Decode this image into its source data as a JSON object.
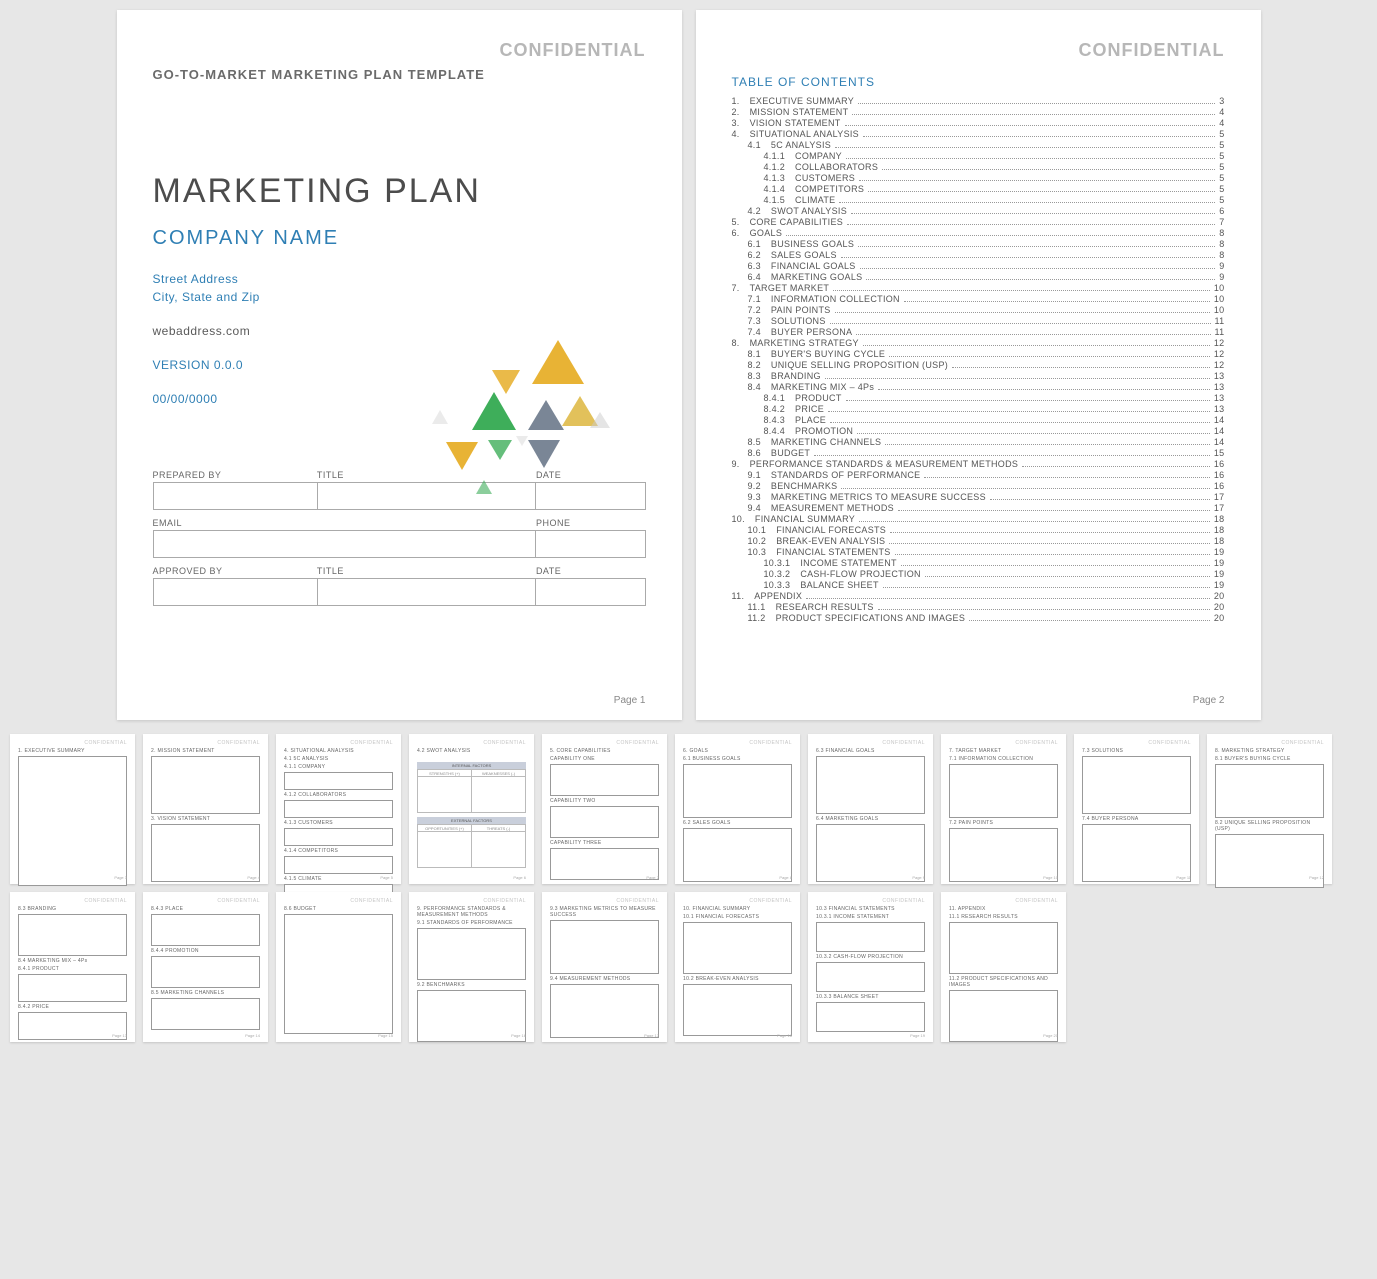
{
  "confidential": "CONFIDENTIAL",
  "template_name": "GO-TO-MARKET MARKETING PLAN TEMPLATE",
  "cover": {
    "title": "MARKETING PLAN",
    "company": "COMPANY NAME",
    "street": "Street Address",
    "csz": "City, State and Zip",
    "web": "webaddress.com",
    "version": "VERSION 0.0.0",
    "date": "00/00/0000"
  },
  "form": {
    "prepared_by": "PREPARED BY",
    "title": "TITLE",
    "date": "DATE",
    "email": "EMAIL",
    "phone": "PHONE",
    "approved_by": "APPROVED BY"
  },
  "page1": "Page 1",
  "page2": "Page 2",
  "toc_title": "TABLE OF CONTENTS",
  "toc": [
    {
      "n": "1.",
      "t": "EXECUTIVE SUMMARY",
      "p": "3",
      "i": 0
    },
    {
      "n": "2.",
      "t": "MISSION STATEMENT",
      "p": "4",
      "i": 0
    },
    {
      "n": "3.",
      "t": "VISION STATEMENT",
      "p": "4",
      "i": 0
    },
    {
      "n": "4.",
      "t": "SITUATIONAL ANALYSIS",
      "p": "5",
      "i": 0
    },
    {
      "n": "4.1",
      "t": "5C ANALYSIS",
      "p": "5",
      "i": 1
    },
    {
      "n": "4.1.1",
      "t": "COMPANY",
      "p": "5",
      "i": 2
    },
    {
      "n": "4.1.2",
      "t": "COLLABORATORS",
      "p": "5",
      "i": 2
    },
    {
      "n": "4.1.3",
      "t": "CUSTOMERS",
      "p": "5",
      "i": 2
    },
    {
      "n": "4.1.4",
      "t": "COMPETITORS",
      "p": "5",
      "i": 2
    },
    {
      "n": "4.1.5",
      "t": "CLIMATE",
      "p": "5",
      "i": 2
    },
    {
      "n": "4.2",
      "t": "SWOT ANALYSIS",
      "p": "6",
      "i": 1
    },
    {
      "n": "5.",
      "t": "CORE CAPABILITIES",
      "p": "7",
      "i": 0
    },
    {
      "n": "6.",
      "t": "GOALS",
      "p": "8",
      "i": 0
    },
    {
      "n": "6.1",
      "t": "BUSINESS GOALS",
      "p": "8",
      "i": 1
    },
    {
      "n": "6.2",
      "t": "SALES GOALS",
      "p": "8",
      "i": 1
    },
    {
      "n": "6.3",
      "t": "FINANCIAL GOALS",
      "p": "9",
      "i": 1
    },
    {
      "n": "6.4",
      "t": "MARKETING GOALS",
      "p": "9",
      "i": 1
    },
    {
      "n": "7.",
      "t": "TARGET MARKET",
      "p": "10",
      "i": 0
    },
    {
      "n": "7.1",
      "t": "INFORMATION COLLECTION",
      "p": "10",
      "i": 1
    },
    {
      "n": "7.2",
      "t": "PAIN POINTS",
      "p": "10",
      "i": 1
    },
    {
      "n": "7.3",
      "t": "SOLUTIONS",
      "p": "11",
      "i": 1
    },
    {
      "n": "7.4",
      "t": "BUYER PERSONA",
      "p": "11",
      "i": 1
    },
    {
      "n": "8.",
      "t": "MARKETING STRATEGY",
      "p": "12",
      "i": 0
    },
    {
      "n": "8.1",
      "t": "BUYER'S BUYING CYCLE",
      "p": "12",
      "i": 1
    },
    {
      "n": "8.2",
      "t": "UNIQUE SELLING PROPOSITION (USP)",
      "p": "12",
      "i": 1
    },
    {
      "n": "8.3",
      "t": "BRANDING",
      "p": "13",
      "i": 1
    },
    {
      "n": "8.4",
      "t": "MARKETING MIX – 4Ps",
      "p": "13",
      "i": 1
    },
    {
      "n": "8.4.1",
      "t": "PRODUCT",
      "p": "13",
      "i": 2
    },
    {
      "n": "8.4.2",
      "t": "PRICE",
      "p": "13",
      "i": 2
    },
    {
      "n": "8.4.3",
      "t": "PLACE",
      "p": "14",
      "i": 2
    },
    {
      "n": "8.4.4",
      "t": "PROMOTION",
      "p": "14",
      "i": 2
    },
    {
      "n": "8.5",
      "t": "MARKETING CHANNELS",
      "p": "14",
      "i": 1
    },
    {
      "n": "8.6",
      "t": "BUDGET",
      "p": "15",
      "i": 1
    },
    {
      "n": "9.",
      "t": "PERFORMANCE STANDARDS & MEASUREMENT METHODS",
      "p": "16",
      "i": 0
    },
    {
      "n": "9.1",
      "t": "STANDARDS OF PERFORMANCE",
      "p": "16",
      "i": 1
    },
    {
      "n": "9.2",
      "t": "BENCHMARKS",
      "p": "16",
      "i": 1
    },
    {
      "n": "9.3",
      "t": "MARKETING METRICS TO MEASURE SUCCESS",
      "p": "17",
      "i": 1
    },
    {
      "n": "9.4",
      "t": "MEASUREMENT METHODS",
      "p": "17",
      "i": 1
    },
    {
      "n": "10.",
      "t": "FINANCIAL SUMMARY",
      "p": "18",
      "i": 0
    },
    {
      "n": "10.1",
      "t": "FINANCIAL FORECASTS",
      "p": "18",
      "i": 1
    },
    {
      "n": "10.2",
      "t": "BREAK-EVEN ANALYSIS",
      "p": "18",
      "i": 1
    },
    {
      "n": "10.3",
      "t": "FINANCIAL STATEMENTS",
      "p": "19",
      "i": 1
    },
    {
      "n": "10.3.1",
      "t": "INCOME STATEMENT",
      "p": "19",
      "i": 2
    },
    {
      "n": "10.3.2",
      "t": "CASH-FLOW PROJECTION",
      "p": "19",
      "i": 2
    },
    {
      "n": "10.3.3",
      "t": "BALANCE SHEET",
      "p": "19",
      "i": 2
    },
    {
      "n": "11.",
      "t": "APPENDIX",
      "p": "20",
      "i": 0
    },
    {
      "n": "11.1",
      "t": "RESEARCH RESULTS",
      "p": "20",
      "i": 1
    },
    {
      "n": "11.2",
      "t": "PRODUCT SPECIFICATIONS AND IMAGES",
      "p": "20",
      "i": 1
    }
  ],
  "thumbs": [
    {
      "p": "3",
      "sections": [
        {
          "h": "1. EXECUTIVE SUMMARY",
          "hb": 130
        }
      ]
    },
    {
      "p": "4",
      "sections": [
        {
          "h": "2. MISSION STATEMENT",
          "hb": 58
        },
        {
          "h": "3. VISION STATEMENT",
          "hb": 58
        }
      ]
    },
    {
      "p": "5",
      "sections": [
        {
          "h": "4. SITUATIONAL ANALYSIS",
          "hb": 0
        },
        {
          "h": "4.1 5C ANALYSIS",
          "hb": 0
        },
        {
          "h": "4.1.1 COMPANY",
          "hb": 18
        },
        {
          "h": "4.1.2 COLLABORATORS",
          "hb": 18
        },
        {
          "h": "4.1.3 CUSTOMERS",
          "hb": 18
        },
        {
          "h": "4.1.4 COMPETITORS",
          "hb": 18
        },
        {
          "h": "4.1.5 CLIMATE",
          "hb": 18
        }
      ]
    },
    {
      "p": "6",
      "swot": true,
      "sections": [
        {
          "h": "4.2 SWOT ANALYSIS",
          "hb": 0
        }
      ]
    },
    {
      "p": "7",
      "sections": [
        {
          "h": "5. CORE CAPABILITIES",
          "hb": 0
        },
        {
          "h": "CAPABILITY ONE",
          "hb": 32
        },
        {
          "h": "CAPABILITY TWO",
          "hb": 32
        },
        {
          "h": "CAPABILITY THREE",
          "hb": 32
        }
      ]
    },
    {
      "p": "8",
      "sections": [
        {
          "h": "6. GOALS",
          "hb": 0
        },
        {
          "h": "6.1 BUSINESS GOALS",
          "hb": 54
        },
        {
          "h": "6.2 SALES GOALS",
          "hb": 54
        }
      ]
    },
    {
      "p": "9",
      "sections": [
        {
          "h": "6.3 FINANCIAL GOALS",
          "hb": 58
        },
        {
          "h": "6.4 MARKETING GOALS",
          "hb": 58
        }
      ]
    },
    {
      "p": "10",
      "sections": [
        {
          "h": "7. TARGET MARKET",
          "hb": 0
        },
        {
          "h": "7.1 INFORMATION COLLECTION",
          "hb": 54
        },
        {
          "h": "7.2 PAIN POINTS",
          "hb": 54
        }
      ]
    },
    {
      "p": "11",
      "sections": [
        {
          "h": "7.3 SOLUTIONS",
          "hb": 58
        },
        {
          "h": "7.4 BUYER PERSONA",
          "hb": 58
        }
      ]
    },
    {
      "p": "12",
      "sections": [
        {
          "h": "8. MARKETING STRATEGY",
          "hb": 0
        },
        {
          "h": "8.1 BUYER'S BUYING CYCLE",
          "hb": 54
        },
        {
          "h": "8.2 UNIQUE SELLING PROPOSITION (USP)",
          "hb": 54
        }
      ]
    },
    {
      "p": "13",
      "sections": [
        {
          "h": "8.3 BRANDING",
          "hb": 42
        },
        {
          "h": "8.4 MARKETING MIX – 4Ps",
          "hb": 0
        },
        {
          "h": "8.4.1 PRODUCT",
          "hb": 28
        },
        {
          "h": "8.4.2 PRICE",
          "hb": 28
        }
      ]
    },
    {
      "p": "14",
      "sections": [
        {
          "h": "8.4.3 PLACE",
          "hb": 32
        },
        {
          "h": "8.4.4 PROMOTION",
          "hb": 32
        },
        {
          "h": "8.5 MARKETING CHANNELS",
          "hb": 32
        }
      ]
    },
    {
      "p": "15",
      "sections": [
        {
          "h": "8.6 BUDGET",
          "hb": 120
        }
      ]
    },
    {
      "p": "16",
      "sections": [
        {
          "h": "9. PERFORMANCE STANDARDS & MEASUREMENT METHODS",
          "hb": 0
        },
        {
          "h": "9.1 STANDARDS OF PERFORMANCE",
          "hb": 52
        },
        {
          "h": "9.2 BENCHMARKS",
          "hb": 52
        }
      ]
    },
    {
      "p": "17",
      "sections": [
        {
          "h": "9.3 MARKETING METRICS TO MEASURE SUCCESS",
          "hb": 54
        },
        {
          "h": "9.4 MEASUREMENT METHODS",
          "hb": 54
        }
      ]
    },
    {
      "p": "18",
      "sections": [
        {
          "h": "10. FINANCIAL SUMMARY",
          "hb": 0
        },
        {
          "h": "10.1 FINANCIAL FORECASTS",
          "hb": 52
        },
        {
          "h": "10.2 BREAK-EVEN ANALYSIS",
          "hb": 52
        }
      ]
    },
    {
      "p": "19",
      "sections": [
        {
          "h": "10.3 FINANCIAL STATEMENTS",
          "hb": 0
        },
        {
          "h": "10.3.1 INCOME STATEMENT",
          "hb": 30
        },
        {
          "h": "10.3.2 CASH-FLOW PROJECTION",
          "hb": 30
        },
        {
          "h": "10.3.3 BALANCE SHEET",
          "hb": 30
        }
      ]
    },
    {
      "p": "20",
      "sections": [
        {
          "h": "11. APPENDIX",
          "hb": 0
        },
        {
          "h": "11.1 RESEARCH RESULTS",
          "hb": 52
        },
        {
          "h": "11.2 PRODUCT SPECIFICATIONS AND IMAGES",
          "hb": 52
        }
      ]
    }
  ],
  "swot_labels": {
    "internal": "INTERNAL FACTORS",
    "external": "EXTERNAL FACTORS",
    "s": "STRENGTHS (+)",
    "w": "WEAKNESSES (-)",
    "o": "OPPORTUNITIES (+)",
    "t": "THREATS (-)"
  },
  "page_label": "Page"
}
